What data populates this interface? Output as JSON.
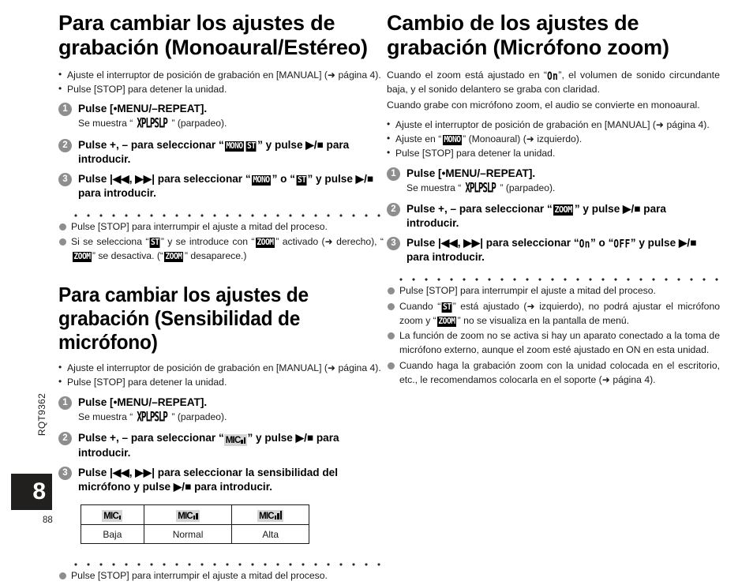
{
  "document": {
    "manual_code": "RQT9362",
    "section_tab": "8",
    "folio": "88"
  },
  "left_column": {
    "section1": {
      "heading": "Para cambiar los ajustes de grabación (Monoaural/Estéreo)",
      "bullets": [
        "Ajuste el interruptor de posición de grabación en [MANUAL] (➜ página 4).",
        "Pulse [STOP] para detener la unidad."
      ],
      "steps": [
        {
          "num": "1",
          "title": "Pulse [•MENU/–REPEAT].",
          "sub_prefix": "Se muestra “",
          "sub_lcd": "XPLPSLP",
          "sub_suffix": "” (parpadeo)."
        },
        {
          "num": "2",
          "title_a": "Pulse +, – para seleccionar “",
          "badge_a": "MONO",
          "badge_b": "ST",
          "title_b": "” y pulse ▶/■ para introducir."
        },
        {
          "num": "3",
          "title_a": "Pulse |◀◀, ▶▶| para seleccionar “",
          "badge_a": "MONO",
          "mid": "” o “",
          "badge_b": "ST",
          "title_b": "” y pulse ▶/■ para introducir."
        }
      ],
      "notes": [
        {
          "text": "Pulse [STOP] para interrumpir el ajuste a mitad del proceso."
        },
        {
          "part1": "Si se selecciona “",
          "badge1": "ST",
          "part2": "” y se introduce con “",
          "badge2": "ZOOM",
          "part3": "” activado (➜ derecho), “",
          "badge3": "ZOOM",
          "part4": "” se desactiva. (“",
          "badge4": "ZOOM",
          "part5": "” desaparece.)"
        }
      ]
    },
    "section2": {
      "heading": "Para cambiar los ajustes de grabación (Sensibilidad de micrófono)",
      "bullets": [
        "Ajuste el interruptor de posición de grabación en [MANUAL] (➜ página 4).",
        "Pulse [STOP] para detener la unidad."
      ],
      "steps": [
        {
          "num": "1",
          "title": "Pulse [•MENU/–REPEAT].",
          "sub_prefix": "Se muestra “",
          "sub_lcd": "XPLPSLP",
          "sub_suffix": "” (parpadeo)."
        },
        {
          "num": "2",
          "title_a": "Pulse +, – para seleccionar “",
          "mic_label": "MIC",
          "title_b": "” y pulse ▶/■ para introducir."
        },
        {
          "num": "3",
          "title": "Pulse |◀◀, ▶▶| para seleccionar la sensibilidad del micrófono y pulse ▶/■ para introducir."
        }
      ],
      "mic_table": {
        "glyph_label": "MIC",
        "bars": [
          1,
          2,
          3
        ],
        "labels": [
          "Baja",
          "Normal",
          "Alta"
        ]
      },
      "notes": [
        {
          "text": "Pulse [STOP] para interrumpir el ajuste a mitad del proceso."
        }
      ]
    }
  },
  "right_column": {
    "section": {
      "heading": "Cambio de los ajustes de grabación (Micrófono zoom)",
      "lead_part1": "Cuando el zoom está ajustado en “",
      "lead_lcd": "On",
      "lead_part2": "”, el volumen de sonido circundante baja, y el sonido delantero se graba con claridad.",
      "lead_line2": "Cuando grabe con micrófono zoom, el audio se convierte en monoaural.",
      "bullets": [
        {
          "text": "Ajuste el interruptor de posición de grabación en [MANUAL] (➜ página 4)."
        },
        {
          "part1": "Ajuste en “",
          "badge": "MONO",
          "part2": "” (Monoaural) (➜ izquierdo)."
        },
        {
          "text": "Pulse [STOP] para detener la unidad."
        }
      ],
      "steps": [
        {
          "num": "1",
          "title": "Pulse [•MENU/–REPEAT].",
          "sub_prefix": "Se muestra “",
          "sub_lcd": "XPLPSLP",
          "sub_suffix": "” (parpadeo)."
        },
        {
          "num": "2",
          "title_a": "Pulse +, – para seleccionar “",
          "badge_a": "ZOOM",
          "title_b": "” y pulse ▶/■ para introducir."
        },
        {
          "num": "3",
          "title_a": "Pulse |◀◀, ▶▶| para seleccionar “",
          "lcd_a": "On",
          "mid": "” o “",
          "lcd_b": "OFF",
          "title_b": "” y pulse ▶/■ para introducir."
        }
      ],
      "notes": [
        {
          "text": "Pulse [STOP] para interrumpir el ajuste a mitad del proceso."
        },
        {
          "part1": "Cuando “",
          "badge1": "ST",
          "part2": "” está ajustado (➜ izquierdo), no podrá ajustar el micrófono zoom y “",
          "badge2": "ZOOM",
          "part3": "” no se visualiza en la pantalla de menú."
        },
        {
          "text": "La función de zoom no se activa si hay un aparato conectado a la toma de micrófono externo, aunque el zoom esté ajustado en ON en esta unidad."
        },
        {
          "text": "Cuando haga la grabación zoom con la unidad colocada en el escritorio, etc., le recomendamos colocarla en el soporte (➜ página 4)."
        }
      ]
    }
  }
}
